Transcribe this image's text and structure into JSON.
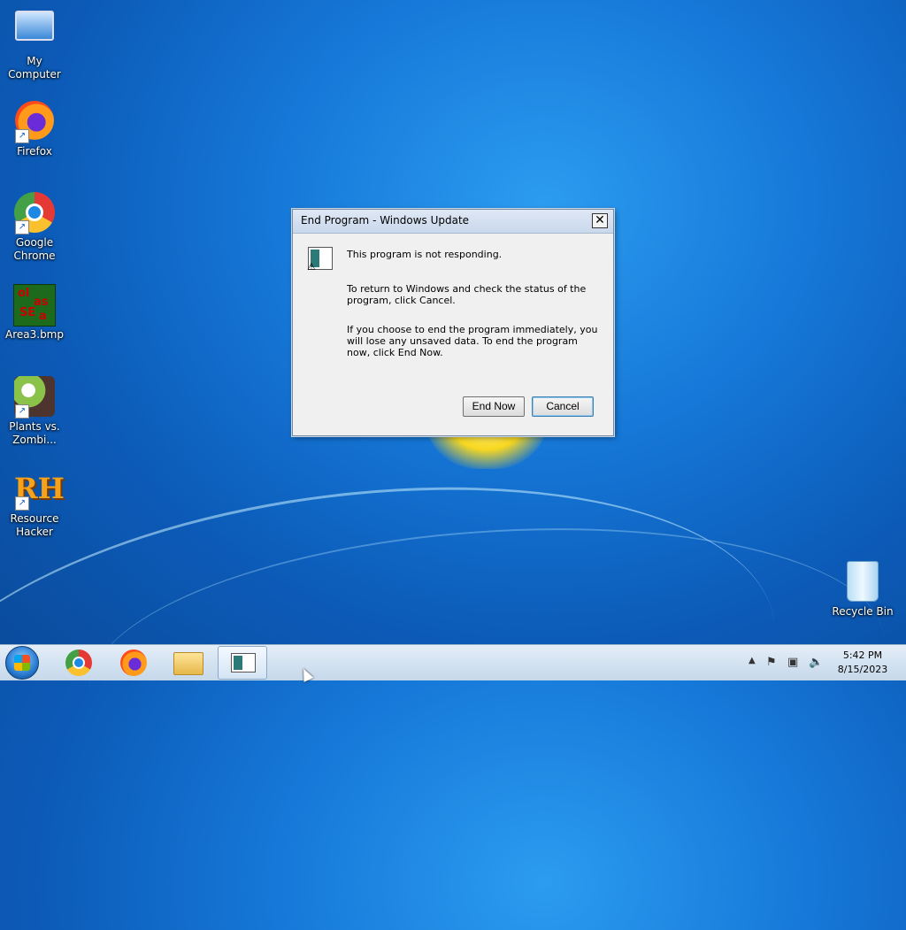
{
  "desktop": {
    "icons": [
      {
        "label": "My Computer",
        "icon": "computer-icon"
      },
      {
        "label": "Firefox",
        "icon": "firefox-icon"
      },
      {
        "label": "Google Chrome",
        "icon": "chrome-icon"
      },
      {
        "label": "Area3.bmp",
        "icon": "bitmap-icon"
      },
      {
        "label": "Plants vs. Zombi...",
        "icon": "plants-vs-zombies-icon"
      },
      {
        "label": "Resource Hacker",
        "icon": "resource-hacker-icon"
      },
      {
        "label": "Recycle Bin",
        "icon": "recycle-bin-icon"
      }
    ]
  },
  "dialog": {
    "title": "End Program - Windows Update",
    "close_label": "✕",
    "message1": "This program is not responding.",
    "message2": "To return to Windows and check the status of the program, click Cancel.",
    "message3": "If you choose to end the program immediately, you will lose any unsaved data. To end the program now, click End Now.",
    "end_now_label": "End Now",
    "cancel_label": "Cancel"
  },
  "taskbar": {
    "items": [
      "start-button",
      "chrome",
      "firefox",
      "file-explorer",
      "windows-update"
    ],
    "clock_time": "5:42 PM",
    "clock_date": "8/15/2023"
  },
  "colors": {
    "desktop": "#1678d8",
    "dialog_bg": "#f0f0f0",
    "taskbar": "#d4e4f4"
  }
}
